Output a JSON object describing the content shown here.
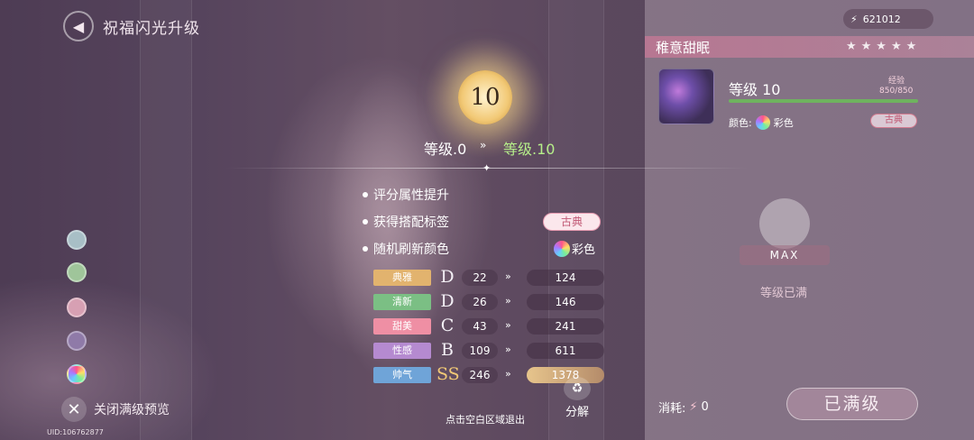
{
  "title": "祝福闪光升级",
  "currency": {
    "value": "621012"
  },
  "item": {
    "name": "稚意甜眠",
    "level_label": "等级 10",
    "exp_label": "经验",
    "exp_value": "850/850",
    "color_label": "颜色:",
    "color_value": "彩色",
    "tag": "古典"
  },
  "max": {
    "ribbon": "MAX",
    "text": "等级已满"
  },
  "consume": {
    "label": "消耗:",
    "value": "0"
  },
  "maxed_button": "已满级",
  "upgrade": {
    "level": "10",
    "from": "等级.0",
    "arrow": "»",
    "to": "等级.10"
  },
  "perks": [
    {
      "label": "评分属性提升"
    },
    {
      "label": "获得搭配标签",
      "tag": "古典"
    },
    {
      "label": "随机刷新颜色",
      "color": "彩色"
    }
  ],
  "stats": [
    {
      "name": "典雅",
      "grade": "D",
      "from": "22",
      "to": "124",
      "color": "#e2b36e"
    },
    {
      "name": "清新",
      "grade": "D",
      "from": "26",
      "to": "146",
      "color": "#7bbf84"
    },
    {
      "name": "甜美",
      "grade": "C",
      "from": "43",
      "to": "241",
      "color": "#ef8fa4"
    },
    {
      "name": "性感",
      "grade": "B",
      "from": "109",
      "to": "611",
      "color": "#b58ad0"
    },
    {
      "name": "帅气",
      "grade": "SS",
      "from": "246",
      "to": "1378",
      "color": "#6fa4d8"
    }
  ],
  "stat_arrow": "»",
  "exit_hint": "点击空白区域退出",
  "decompose": "分解",
  "close_preview": "关闭满级预览",
  "uid": "UID:106762877",
  "colors": {
    "accent_gold": "#f2c976",
    "accent_pink": "#c25a76",
    "level_green": "#b6ef8a"
  }
}
